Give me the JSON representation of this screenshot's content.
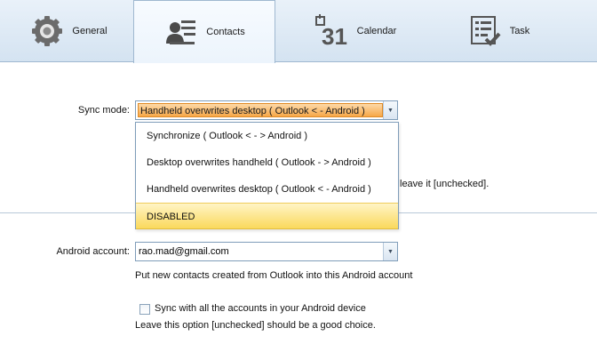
{
  "tabs": [
    {
      "label": "General",
      "icon": "gear-icon"
    },
    {
      "label": "Contacts",
      "icon": "contacts-icon"
    },
    {
      "label": "Calendar",
      "icon": "calendar-icon",
      "icon_text": "31"
    },
    {
      "label": "Task",
      "icon": "task-checklist-icon"
    }
  ],
  "active_tab": "Contacts",
  "sync": {
    "label": "Sync mode:",
    "selected": "Handheld overwrites desktop  ( Outlook < - Android )",
    "options": [
      "Synchronize  ( Outlook < - > Android )",
      "Desktop overwrites handheld  ( Outlook - > Android )",
      "Handheld overwrites desktop  ( Outlook < - Android )",
      "DISABLED"
    ],
    "highlighted_option": "DISABLED",
    "partial_text": "leave it [unchecked]."
  },
  "account": {
    "label": "Android account:",
    "value": "rao.mad@gmail.com",
    "hint": "Put new contacts created from Outlook into this Android account"
  },
  "sync_all": {
    "label": "Sync with all the accounts in your Android device",
    "checked": false,
    "hint": "Leave this option [unchecked] should be a good choice."
  },
  "colors": {
    "selection_orange": "#f6a748",
    "highlight_yellow": "#fad95c",
    "tabbar": "#d4e3f1"
  }
}
